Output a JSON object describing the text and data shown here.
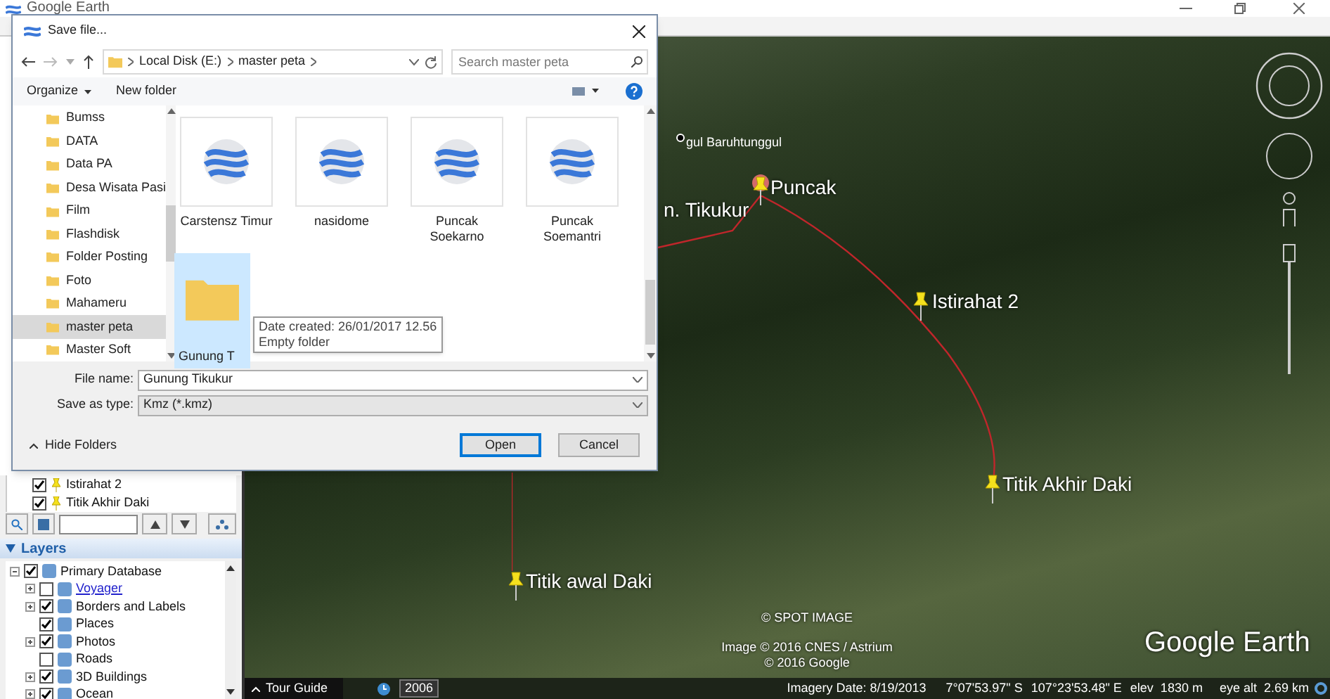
{
  "window": {
    "title": "Google Earth"
  },
  "places": [
    {
      "label": "Istirahat 2",
      "checked": true
    },
    {
      "label": "Titik Akhir Daki",
      "checked": true
    }
  ],
  "layers": {
    "title": "Layers",
    "expanded": true,
    "items": [
      {
        "label": "Primary Database",
        "checked": true,
        "kind": "layer",
        "expanded": true,
        "children": [
          {
            "label": "Voyager",
            "checked": false,
            "kind": "link",
            "expanded": false
          },
          {
            "label": "Borders and Labels",
            "checked": true,
            "kind": "layer",
            "expanded": false
          },
          {
            "label": "Places",
            "checked": true,
            "kind": "layer"
          },
          {
            "label": "Photos",
            "checked": true,
            "kind": "layer",
            "expanded": false
          },
          {
            "label": "Roads",
            "checked": false,
            "kind": "layer"
          },
          {
            "label": "3D Buildings",
            "checked": true,
            "kind": "layer",
            "expanded": false
          },
          {
            "label": "Ocean",
            "checked": true,
            "kind": "layer",
            "expanded": false
          }
        ]
      }
    ]
  },
  "map": {
    "place_label": "gul Baruhtunggul",
    "placemarks": [
      {
        "label": "Puncak",
        "kind": "highlighted_pin"
      },
      {
        "label": "n. Tikukur",
        "kind": "label"
      },
      {
        "label": "Istirahat 2",
        "kind": "pin"
      },
      {
        "label": "Titik Akhir Daki",
        "kind": "pin"
      },
      {
        "label": "Titik awal Daki",
        "kind": "pin"
      }
    ],
    "credits": [
      "© SPOT IMAGE",
      "Image © 2016 CNES / Astrium",
      "© 2016 Google"
    ],
    "logo": "Google Earth"
  },
  "status_bar": {
    "tour_guide": "Tour Guide",
    "year": "2006",
    "imagery_date": "Imagery Date: 8/19/2013",
    "latitude": "7°07'53.97\" S",
    "longitude": "107°23'53.48\" E",
    "elevation": "elev  1830 m",
    "eye_alt": "eye alt  2.69 km"
  },
  "dialog": {
    "title": "Save file...",
    "path": [
      "Local Disk (E:)",
      "master peta"
    ],
    "search": {
      "placeholder": "Search master peta"
    },
    "toolbar": [
      "Organize",
      "New folder"
    ],
    "folders": [
      {
        "label": "Bumss",
        "selected": false
      },
      {
        "label": "DATA",
        "selected": false
      },
      {
        "label": "Data PA",
        "selected": false
      },
      {
        "label": "Desa Wisata Pasi",
        "selected": false
      },
      {
        "label": "Film",
        "selected": false
      },
      {
        "label": "Flashdisk",
        "selected": false
      },
      {
        "label": "Folder Posting",
        "selected": false
      },
      {
        "label": "Foto",
        "selected": false
      },
      {
        "label": "Mahameru",
        "selected": false
      },
      {
        "label": "master peta",
        "selected": true
      },
      {
        "label": "Master Soft",
        "selected": false
      }
    ],
    "files": [
      {
        "label": "Carstensz Timur",
        "kind": "kmz",
        "selected": false
      },
      {
        "label": "nasidome",
        "kind": "kmz",
        "selected": false
      },
      {
        "label": "Puncak Soekarno",
        "kind": "kmz",
        "selected": false
      },
      {
        "label": "Puncak Soemantri",
        "kind": "kmz",
        "selected": false
      },
      {
        "label": "Gunung T",
        "kind": "folder",
        "selected": true
      }
    ],
    "tooltip": [
      "Date created: 26/01/2017 12.56",
      "Empty folder"
    ],
    "file_name": {
      "label": "File name:",
      "value": "Gunung Tikukur"
    },
    "save_type": {
      "label": "Save as type:",
      "value": "Kmz (*.kmz)"
    },
    "hide_folders": "Hide Folders",
    "buttons": [
      {
        "label": "Open",
        "kind": "primary"
      },
      {
        "label": "Cancel",
        "kind": "secondary"
      }
    ]
  }
}
